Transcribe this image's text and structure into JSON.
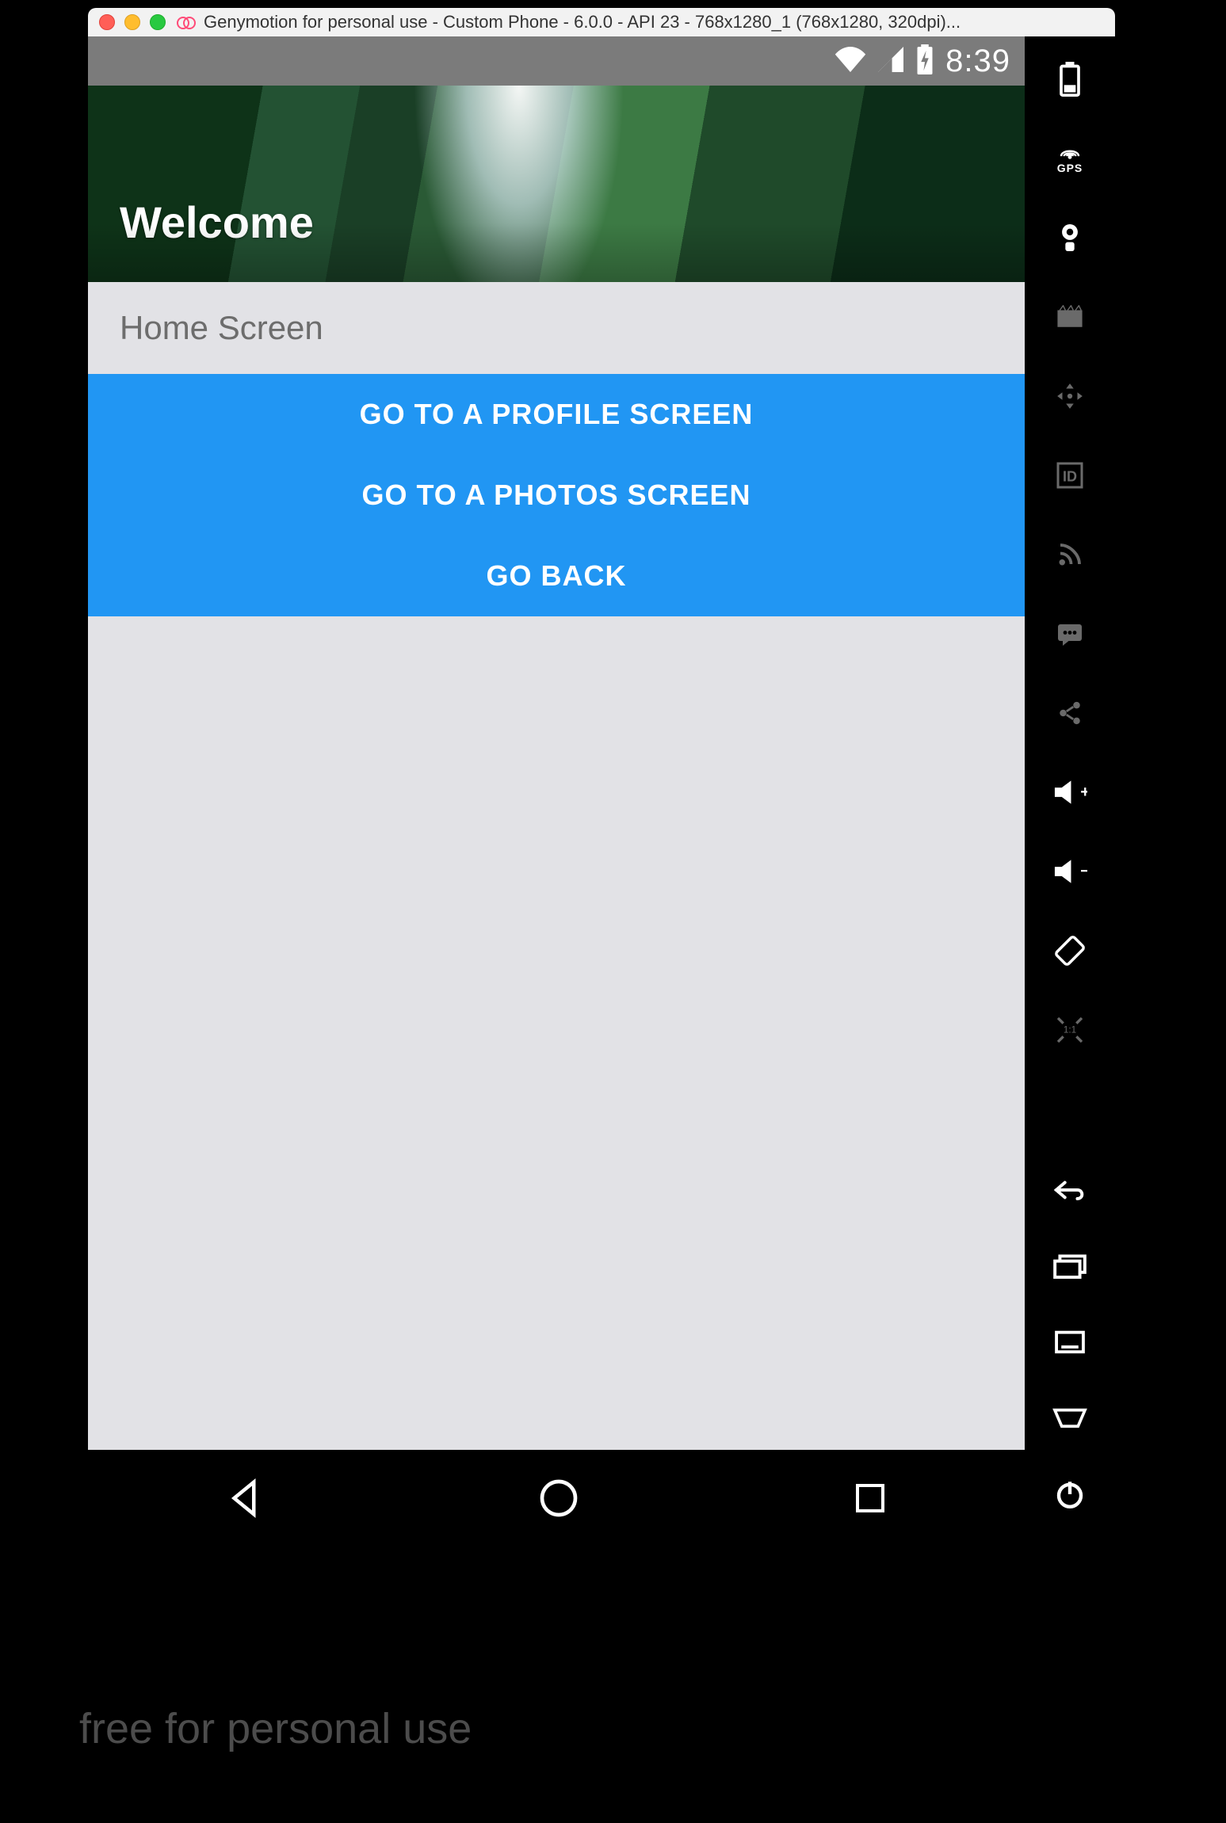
{
  "window": {
    "title": "Genymotion for personal use - Custom Phone - 6.0.0 - API 23 - 768x1280_1 (768x1280, 320dpi)..."
  },
  "statusbar": {
    "time": "8:39"
  },
  "app": {
    "header_title": "Welcome",
    "section_label": "Home Screen",
    "buttons": {
      "profile": "GO TO A PROFILE SCREEN",
      "photos": "GO TO A PHOTOS SCREEN",
      "back": "GO BACK"
    }
  },
  "sidebar": {
    "gps_label": "GPS"
  },
  "watermark": "free for personal use"
}
